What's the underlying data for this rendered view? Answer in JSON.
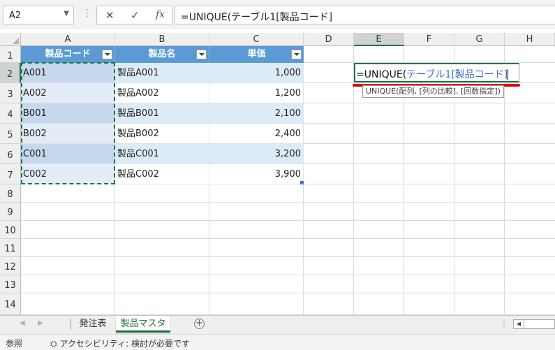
{
  "formula_bar": {
    "name_box": "A2",
    "cancel_icon": "✕",
    "enter_icon": "✓",
    "fx_label": "fx",
    "formula": "=UNIQUE(テーブル1[製品コード]"
  },
  "columns": [
    "A",
    "B",
    "C",
    "D",
    "E",
    "F",
    "G",
    "H"
  ],
  "rows": [
    "1",
    "2",
    "3",
    "4",
    "5",
    "6",
    "7",
    "8",
    "9",
    "10",
    "11",
    "12",
    "13",
    "14"
  ],
  "table": {
    "headers": [
      "製品コード",
      "製品名",
      "単価"
    ],
    "rows": [
      {
        "code": "A001",
        "name": "製品A001",
        "price": "1,000"
      },
      {
        "code": "A002",
        "name": "製品A002",
        "price": "1,200"
      },
      {
        "code": "B001",
        "name": "製品B001",
        "price": "2,100"
      },
      {
        "code": "B002",
        "name": "製品B002",
        "price": "2,400"
      },
      {
        "code": "C001",
        "name": "製品C001",
        "price": "3,200"
      },
      {
        "code": "C002",
        "name": "製品C002",
        "price": "3,900"
      }
    ]
  },
  "edit_cell": {
    "func_part": "=UNIQUE(",
    "ref_part": "テーブル1[製品コード]",
    "tooltip": "UNIQUE(配列, [列の比較], [回数指定])"
  },
  "sheets": {
    "tab1": "発注表",
    "tab2": "製品マスタ",
    "add": "+"
  },
  "status": {
    "mode": "参照",
    "accessibility": "アクセシビリティ: 検討が必要です"
  },
  "colors": {
    "accent": "#217346",
    "table_header": "#5b9bd5",
    "band": "#ddebf7",
    "highlight": "#e00000"
  }
}
